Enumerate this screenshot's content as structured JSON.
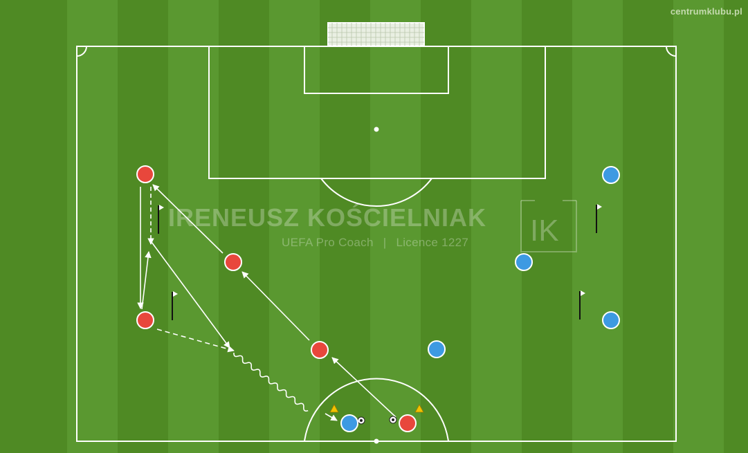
{
  "credit": "centrumklubu.pl",
  "watermark": {
    "name": "IRENEUSZ KOŚCIELNIAK",
    "role": "UEFA Pro Coach",
    "separator": "|",
    "licence": "Licence 1227",
    "logo_text": "IK"
  },
  "colors": {
    "pitch_dark": "#4f8a24",
    "pitch_light": "#5c9a2c",
    "line": "#ffffff",
    "red_player": "#e8473c",
    "blue_player": "#3d9ae2",
    "cone": "#f2c200",
    "flag": "#ffffff"
  },
  "players": {
    "red": [
      "red-1",
      "red-2",
      "red-3",
      "red-4",
      "red-5"
    ],
    "blue": [
      "blue-1",
      "blue-2",
      "blue-3",
      "blue-4",
      "blue-5",
      "blue-6"
    ]
  },
  "equipment": {
    "flags": 4,
    "cones": 2,
    "balls": 2
  },
  "arrow_types": [
    "pass-solid",
    "run-dashed",
    "dribble-wavy"
  ]
}
